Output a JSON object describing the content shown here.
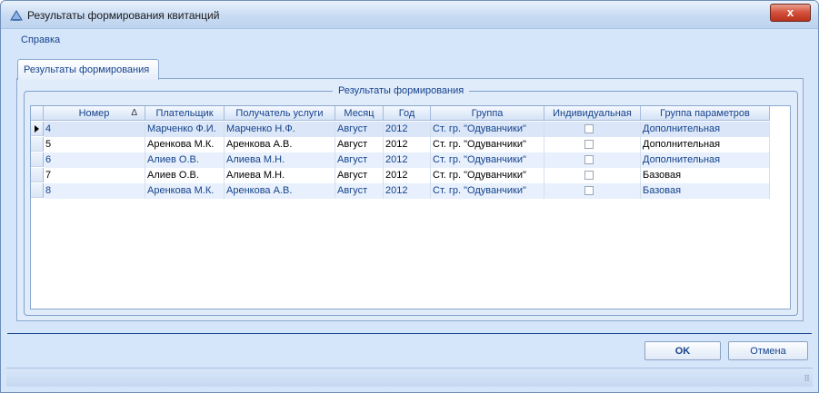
{
  "window": {
    "title": "Результаты формирования квитанций",
    "close_label": "x"
  },
  "menu": {
    "items": [
      "Справка"
    ]
  },
  "tabs": [
    {
      "label": "Результаты формирования",
      "active": true
    }
  ],
  "group": {
    "title": "Результаты формирования"
  },
  "grid": {
    "columns": [
      "Номер",
      "Плательщик",
      "Получатель услуги",
      "Месяц",
      "Год",
      "Группа",
      "Индивидуальная",
      "Группа параметров"
    ],
    "sort_indicator": "Δ",
    "rows": [
      {
        "num": "4",
        "payer": "Марченко Ф.И.",
        "recipient": "Марченко Н.Ф.",
        "month": "Август",
        "year": "2012",
        "group": "Ст. гр. \"Одуванчики\"",
        "individual": false,
        "param_group": "Дополнительная",
        "current": true
      },
      {
        "num": "5",
        "payer": "Аренкова М.К.",
        "recipient": "Аренкова А.В.",
        "month": "Август",
        "year": "2012",
        "group": "Ст. гр. \"Одуванчики\"",
        "individual": false,
        "param_group": "Дополнительная",
        "current": false
      },
      {
        "num": "6",
        "payer": "Алиев О.В.",
        "recipient": "Алиева М.Н.",
        "month": "Август",
        "year": "2012",
        "group": "Ст. гр. \"Одуванчики\"",
        "individual": false,
        "param_group": "Дополнительная",
        "current": false
      },
      {
        "num": "7",
        "payer": "Алиев О.В.",
        "recipient": "Алиева М.Н.",
        "month": "Август",
        "year": "2012",
        "group": "Ст. гр. \"Одуванчики\"",
        "individual": false,
        "param_group": "Базовая",
        "current": false
      },
      {
        "num": "8",
        "payer": "Аренкова М.К.",
        "recipient": "Аренкова А.В.",
        "month": "Август",
        "year": "2012",
        "group": "Ст. гр. \"Одуванчики\"",
        "individual": false,
        "param_group": "Базовая",
        "current": false
      }
    ]
  },
  "buttons": {
    "ok": "OK",
    "cancel": "Отмена"
  },
  "colors": {
    "accent_text": "#15428b",
    "alt_row": "#e7f0fc",
    "selected_row": "#dbe7f8",
    "window_bg": "#d6e6fa"
  }
}
